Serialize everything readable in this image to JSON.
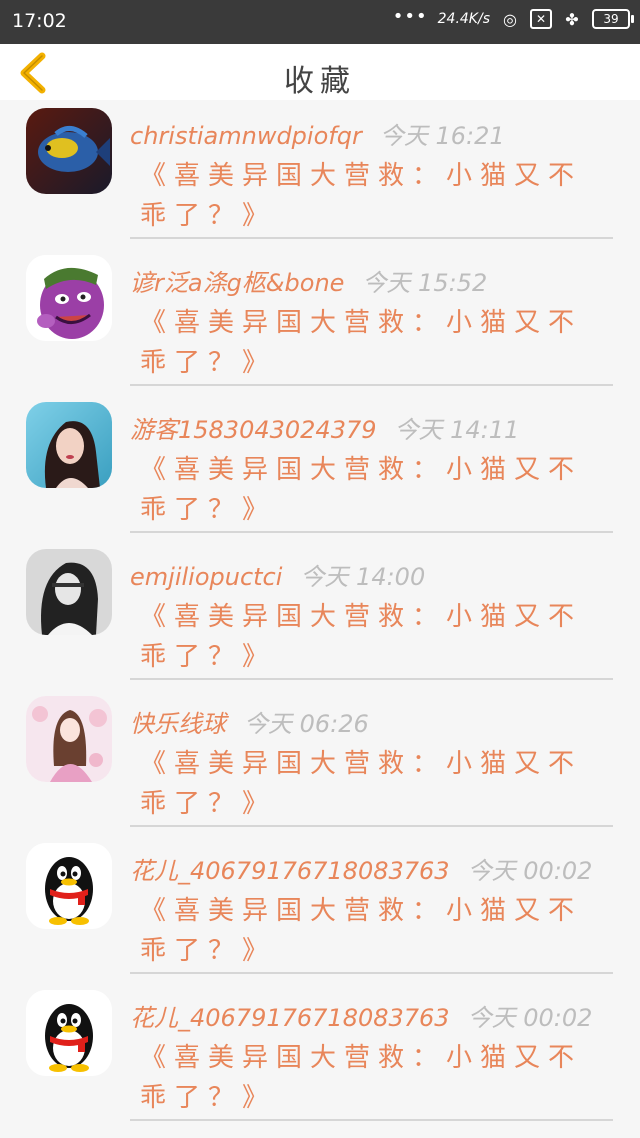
{
  "status_bar": {
    "time": "17:02",
    "network_speed": "24.4K/s",
    "battery": "39"
  },
  "header": {
    "title": "收藏",
    "back_icon": "chevron-left-icon",
    "accent_color": "#f3b100"
  },
  "items": [
    {
      "name": "christiamnwdpiofqr",
      "time": "今天 16:21",
      "title": "《喜美异国大营救：小猫又不乖了？》",
      "avatar": "fish-avatar"
    },
    {
      "name": "谚r泛a涤g柩&bone",
      "time": "今天 15:52",
      "title": "《喜美异国大营救：小猫又不乖了？》",
      "avatar": "cartoon-avatar"
    },
    {
      "name": "游客1583043024379",
      "time": "今天 14:11",
      "title": "《喜美异国大营救：小猫又不乖了？》",
      "avatar": "woman-photo-avatar"
    },
    {
      "name": "emjiliopuctci",
      "time": "今天 14:00",
      "title": "《喜美异国大营救：小猫又不乖了？》",
      "avatar": "bw-photo-avatar"
    },
    {
      "name": "快乐线球",
      "time": "今天 06:26",
      "title": "《喜美异国大营救：小猫又不乖了？》",
      "avatar": "anime-girl-avatar"
    },
    {
      "name": "花儿_40679176718083763",
      "time": "今天 00:02",
      "title": "《喜美异国大营救：小猫又不乖了？》",
      "avatar": "penguin-avatar"
    },
    {
      "name": "花儿_40679176718083763",
      "time": "今天 00:02",
      "title": "《喜美异国大营救：小猫又不乖了？》",
      "avatar": "penguin-avatar"
    }
  ]
}
